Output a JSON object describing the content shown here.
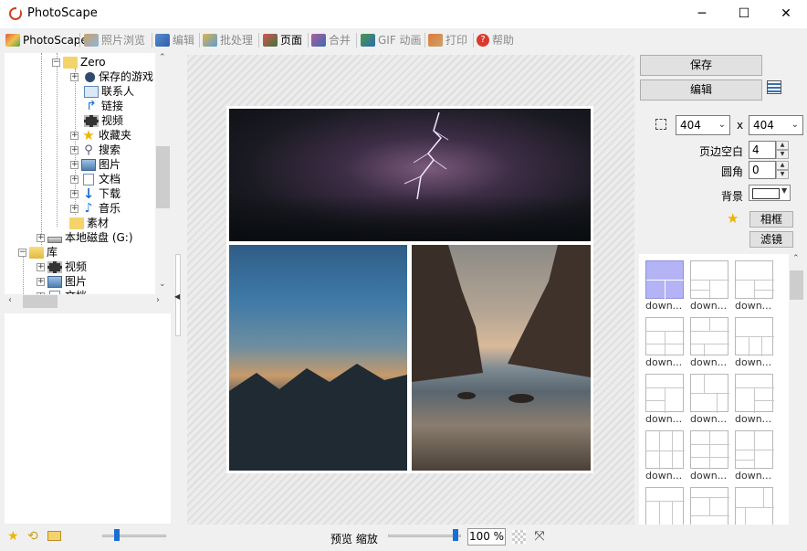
{
  "window": {
    "title": "PhotoScape",
    "controls": {
      "minimize": "─",
      "maximize": "☐",
      "close": "✕"
    }
  },
  "tabs": [
    {
      "label": "PhotoScape",
      "icon": "photoscape-icon",
      "active": true
    },
    {
      "label": "照片浏览",
      "icon": "viewer-icon",
      "active": false
    },
    {
      "label": "编辑",
      "icon": "editor-icon",
      "active": false
    },
    {
      "label": "批处理",
      "icon": "batch-icon",
      "active": false
    },
    {
      "label": "页面",
      "icon": "page-icon",
      "active": true
    },
    {
      "label": "合并",
      "icon": "combine-icon",
      "active": false
    },
    {
      "label": "GIF 动画",
      "icon": "gif-icon",
      "active": false
    },
    {
      "label": "打印",
      "icon": "print-icon",
      "active": false
    },
    {
      "label": "帮助",
      "icon": "help-icon",
      "active": false
    }
  ],
  "tree": {
    "items": [
      {
        "label": "Zero",
        "icon": "folder-icon",
        "expander": "−"
      },
      {
        "label": "保存的游戏",
        "icon": "saved-games-icon",
        "expander": "+"
      },
      {
        "label": "联系人",
        "icon": "contacts-icon",
        "expander": ""
      },
      {
        "label": "链接",
        "icon": "links-icon",
        "expander": ""
      },
      {
        "label": "视频",
        "icon": "video-icon",
        "expander": ""
      },
      {
        "label": "收藏夹",
        "icon": "favorites-icon",
        "expander": "+"
      },
      {
        "label": "搜索",
        "icon": "search-icon",
        "expander": "+"
      },
      {
        "label": "图片",
        "icon": "pictures-icon",
        "expander": "+"
      },
      {
        "label": "文档",
        "icon": "documents-icon",
        "expander": "+"
      },
      {
        "label": "下载",
        "icon": "download-icon",
        "expander": "+"
      },
      {
        "label": "音乐",
        "icon": "music-icon",
        "expander": "+"
      },
      {
        "label": "素材",
        "icon": "folder-icon",
        "expander": ""
      },
      {
        "label": "本地磁盘 (G:)",
        "icon": "drive-icon",
        "expander": "+"
      },
      {
        "label": "库",
        "icon": "library-icon",
        "expander": "−"
      },
      {
        "label": "视频",
        "icon": "video-icon",
        "expander": "+"
      },
      {
        "label": "图片",
        "icon": "pictures-icon",
        "expander": "+"
      },
      {
        "label": "文档",
        "icon": "documents-icon",
        "expander": "+"
      }
    ]
  },
  "right_panel": {
    "save_label": "保存",
    "edit_label": "编辑",
    "width_value": "404",
    "height_value": "404",
    "size_separator": "x",
    "margin_label": "页边空白",
    "margin_value": "4",
    "corner_label": "圆角",
    "corner_value": "0",
    "background_label": "背景",
    "frame_label": "相框",
    "filter_label": "滤镜"
  },
  "templates": {
    "caption": "down...",
    "count": 15,
    "selected_index": 0
  },
  "statusbar": {
    "preview_zoom_label": "预览 缩放",
    "zoom_value": "100 %"
  },
  "colors": {
    "accent": "#1a6fd6",
    "selected_template": "#b3b3f5",
    "folder": "#f5d36b"
  }
}
